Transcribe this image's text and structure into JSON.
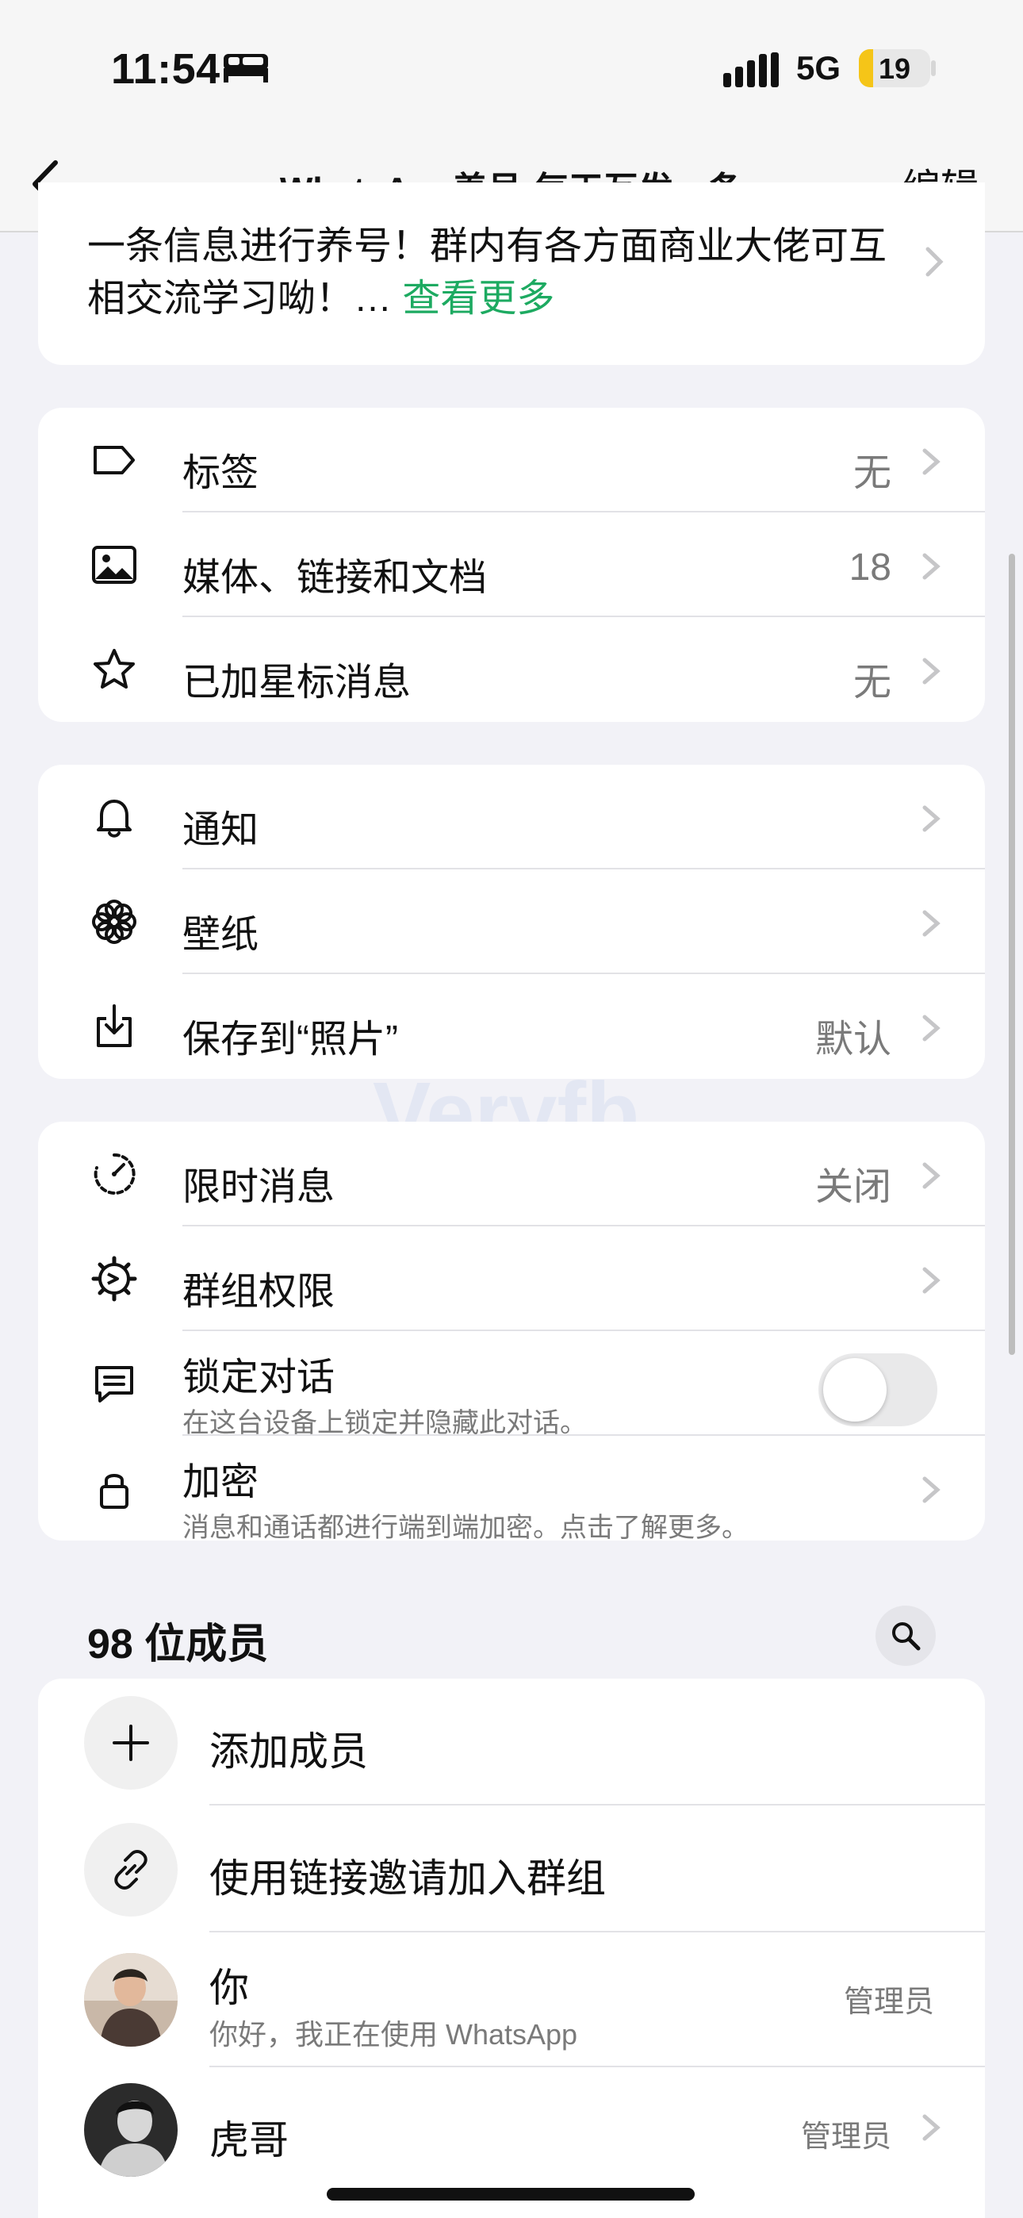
{
  "status_bar": {
    "time": "11:54",
    "network": "5G",
    "battery": "19",
    "icons": [
      "bed-icon",
      "signal-icon",
      "battery-icon"
    ]
  },
  "nav": {
    "title": "WhatsApp养号-每天互发一条",
    "edit": "编辑"
  },
  "description": {
    "text": "一条信息进行养号！群内有各方面商业大佬可互相交流学习呦！… ",
    "more": "查看更多"
  },
  "section1": [
    {
      "label": "标签",
      "value": "无",
      "icon": "tag-icon"
    },
    {
      "label": "媒体、链接和文档",
      "value": "18",
      "icon": "photo-icon"
    },
    {
      "label": "已加星标消息",
      "value": "无",
      "icon": "star-icon"
    }
  ],
  "section2": [
    {
      "label": "通知",
      "value": "",
      "icon": "bell-icon"
    },
    {
      "label": "壁纸",
      "value": "",
      "icon": "flower-icon"
    },
    {
      "label": "保存到“照片”",
      "value": "默认",
      "icon": "download-icon"
    }
  ],
  "section3": [
    {
      "label": "限时消息",
      "value": "关闭",
      "icon": "timer-icon"
    },
    {
      "label": "群组权限",
      "value": "",
      "icon": "settings-icon"
    },
    {
      "label": "锁定对话",
      "sub": "在这台设备上锁定并隐藏此对话。",
      "icon": "chat-lock-icon",
      "toggle": false
    },
    {
      "label": "加密",
      "sub": "消息和通话都进行端到端加密。点击了解更多。",
      "icon": "lock-icon"
    }
  ],
  "members": {
    "header": "98 位成员",
    "actions": [
      {
        "label": "添加成员",
        "icon": "plus-icon"
      },
      {
        "label": "使用链接邀请加入群组",
        "icon": "link-icon"
      }
    ],
    "list": [
      {
        "name": "你",
        "status": "你好，我正在使用 WhatsApp",
        "role": "管理员"
      },
      {
        "name": "虎哥",
        "status": "",
        "role": "管理员"
      }
    ]
  },
  "watermark": "Veryfb"
}
